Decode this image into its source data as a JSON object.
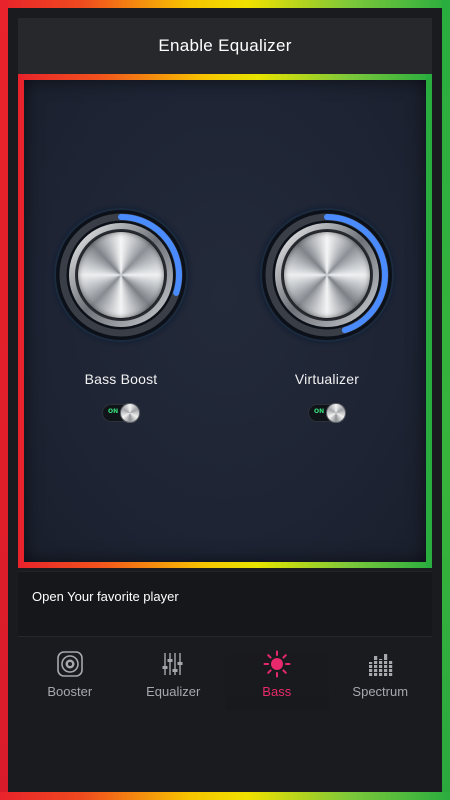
{
  "header": {
    "title": "Enable Equalizer"
  },
  "effects": [
    {
      "label": "Bass Boost",
      "toggle": "ON",
      "level": 0.3
    },
    {
      "label": "Virtualizer",
      "toggle": "ON",
      "level": 0.45
    }
  ],
  "info": {
    "text": "Open Your favorite player"
  },
  "tabs": [
    {
      "label": "Booster",
      "icon": "speaker-icon"
    },
    {
      "label": "Equalizer",
      "icon": "sliders-icon"
    },
    {
      "label": "Bass",
      "icon": "sun-icon",
      "active": true
    },
    {
      "label": "Spectrum",
      "icon": "bars-icon"
    }
  ],
  "colors": {
    "accent": "#e8296b",
    "arc": "#4a8cff",
    "toggle_on": "#37e07d"
  }
}
